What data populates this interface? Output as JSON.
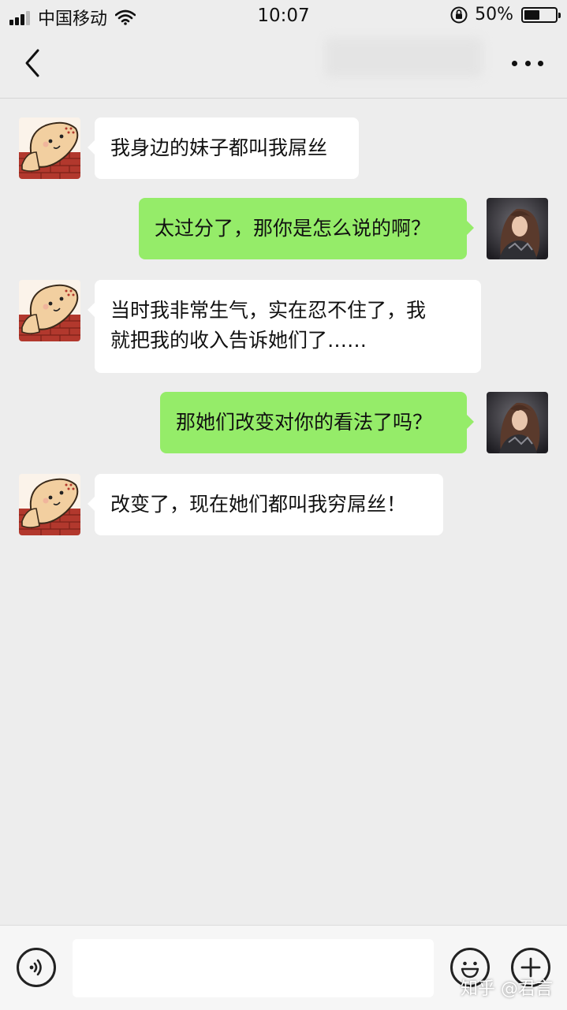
{
  "status_bar": {
    "carrier": "中国移动",
    "time": "10:07",
    "battery_percent_label": "50%",
    "battery_level": 0.5,
    "icons": [
      "signal-icon",
      "wifi-icon",
      "orientation-lock-icon",
      "battery-icon"
    ]
  },
  "nav": {
    "back_icon": "chevron-left-icon",
    "more_icon": "more-dots-icon"
  },
  "messages": [
    {
      "side": "in",
      "avatar": "cartoon-avatar",
      "text": "我身边的妹子都叫我屌丝"
    },
    {
      "side": "out",
      "avatar": "user-photo-avatar",
      "text": "太过分了，那你是怎么说的啊？"
    },
    {
      "side": "in",
      "avatar": "cartoon-avatar",
      "text": "当时我非常生气，实在忍不住了，我\n就把我的收入告诉她们了……"
    },
    {
      "side": "out",
      "avatar": "user-photo-avatar",
      "text": "那她们改变对你的看法了吗？"
    },
    {
      "side": "in",
      "avatar": "cartoon-avatar",
      "text": "改变了，现在她们都叫我穷屌丝！"
    }
  ],
  "input_bar": {
    "voice_icon": "voice-icon",
    "text_value": "",
    "emoji_icon": "emoji-icon",
    "plus_icon": "plus-icon"
  },
  "watermark": "知乎 @君言",
  "colors": {
    "background": "#ededed",
    "bubble_incoming": "#ffffff",
    "bubble_outgoing": "#95ec69"
  }
}
